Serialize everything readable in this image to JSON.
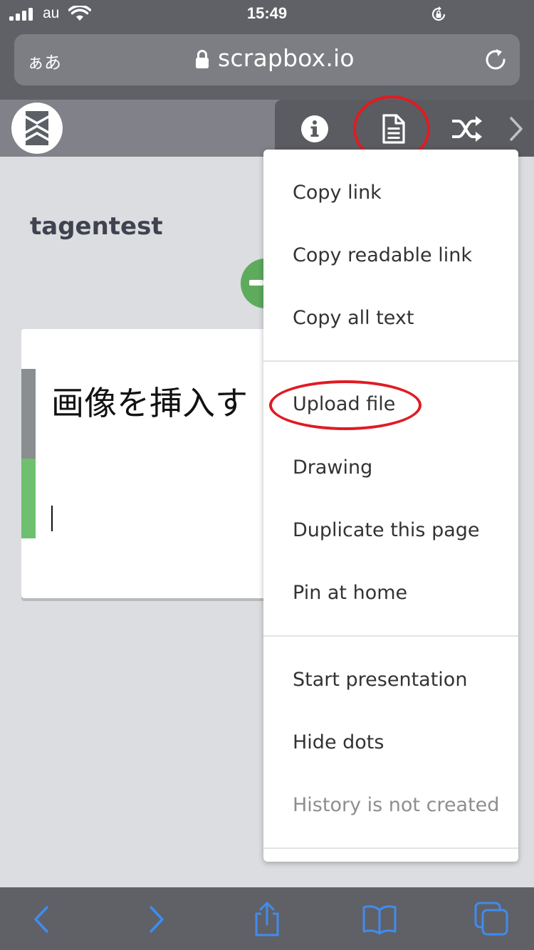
{
  "status_bar": {
    "carrier": "au",
    "time": "15:49"
  },
  "url_bar": {
    "text_size_label": "ぁあ",
    "domain": "scrapbox.io"
  },
  "app": {
    "logo": "scrapbox-logo-icon",
    "toolbar": [
      "info-icon",
      "page-icon",
      "shuffle-icon",
      "chevron-right-icon"
    ]
  },
  "page": {
    "project_title": "tagentest",
    "first_line": "画像を挿入す"
  },
  "page_menu": {
    "items": [
      "Copy link",
      "Copy readable link",
      "Copy all text",
      "Upload file",
      "Drawing",
      "Duplicate this page",
      "Pin at home",
      "Start presentation",
      "Hide dots",
      "History is not created"
    ]
  },
  "bottom_bar": {
    "icons": [
      "back-icon",
      "forward-icon",
      "share-icon",
      "bookmarks-icon",
      "tabs-icon"
    ]
  },
  "colors": {
    "annotation_red": "#e01b23",
    "safari_link_blue": "#3f8cf0",
    "scrapbox_green": "#5eab5e"
  }
}
